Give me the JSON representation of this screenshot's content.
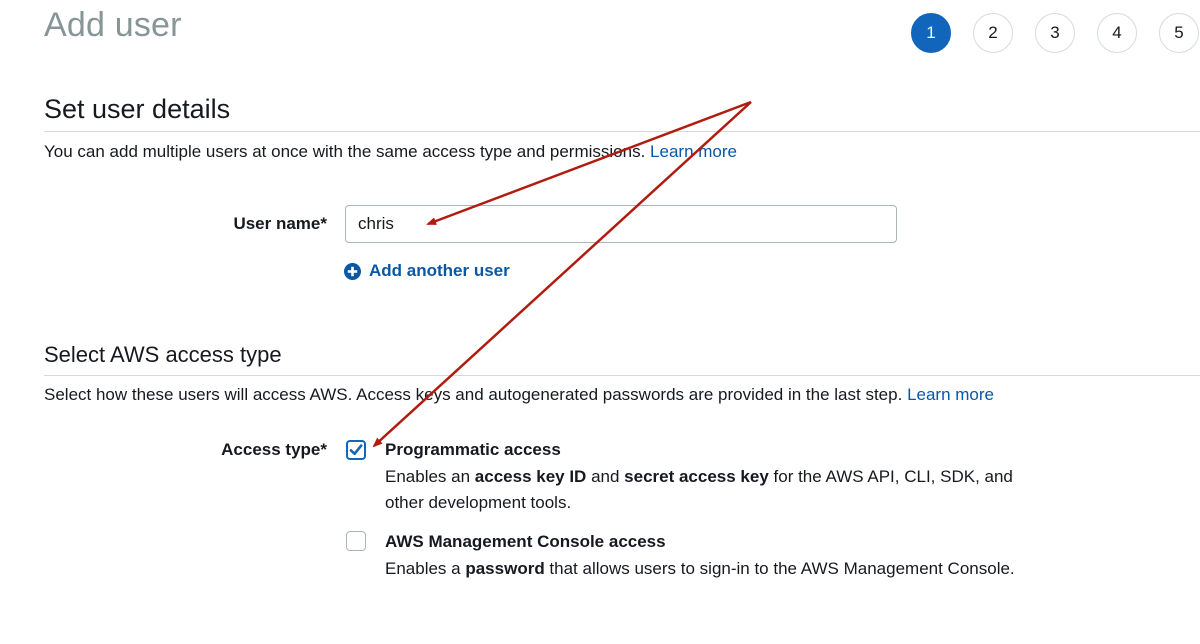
{
  "page": {
    "title": "Add user"
  },
  "steps": [
    "1",
    "2",
    "3",
    "4",
    "5"
  ],
  "active_step": "1",
  "user_details": {
    "heading": "Set user details",
    "description": "You can add multiple users at once with the same access type and permissions.",
    "learn_more": "Learn more",
    "user_name_label": "User name*",
    "user_name_value": "chris",
    "add_another_label": "Add another user"
  },
  "access": {
    "heading": "Select AWS access type",
    "description": "Select how these users will access AWS. Access keys and autogenerated passwords are provided in the last step.",
    "learn_more": "Learn more",
    "access_type_label": "Access type*",
    "programmatic": {
      "title": "Programmatic access",
      "checked": true,
      "desc_1": "Enables an ",
      "desc_2": "access key ID",
      "desc_3": " and ",
      "desc_4": "secret access key",
      "desc_5": " for the AWS API, CLI, SDK, and other development tools."
    },
    "console": {
      "title": "AWS Management Console access",
      "checked": false,
      "desc_1": "Enables a ",
      "desc_2": "password",
      "desc_3": " that allows users to sign-in to the AWS Management Console."
    }
  },
  "colors": {
    "accent": "#1166bb",
    "link": "#0a57a4",
    "title_gray": "#879596",
    "annotation_arrow": "#b01c10"
  },
  "icons": {
    "add": "plus-circle-icon",
    "check": "checkmark-icon"
  }
}
